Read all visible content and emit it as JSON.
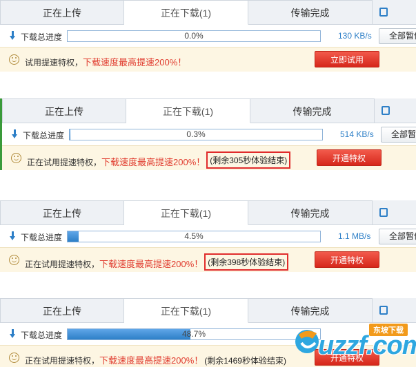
{
  "tabs": {
    "uploading": "正在上传",
    "downloading": "正在下载(1)",
    "completed": "传输完成"
  },
  "progress_label": "下载总进度",
  "pause_all_label": "全部暂停",
  "promo": {
    "trial_text": "试用提速特权，",
    "trying_text": "正在试用提速特权，",
    "highlight": "下载速度最高提速200%！",
    "try_now": "立即试用",
    "activate": "开通特权"
  },
  "panels": [
    {
      "progress": 0.0,
      "progress_text": "0.0%",
      "speed": "130 KB/s",
      "remaining": ""
    },
    {
      "progress": 0.3,
      "progress_text": "0.3%",
      "speed": "514 KB/s",
      "remaining": "(剩余305秒体验结束)"
    },
    {
      "progress": 4.5,
      "progress_text": "4.5%",
      "speed": "1.1 MB/s",
      "remaining": "(剩余398秒体验结束)"
    },
    {
      "progress": 48.7,
      "progress_text": "48.7%",
      "speed": "",
      "remaining": "(剩余1469秒体验结束)"
    }
  ],
  "watermark": {
    "brand": "uzzf.com",
    "badge": "东坡下载"
  },
  "colors": {
    "accent_blue": "#2d7fc7",
    "promo_red": "#e03b2e",
    "button_red": "#d6271b",
    "promo_bg": "#fdf6e3"
  }
}
